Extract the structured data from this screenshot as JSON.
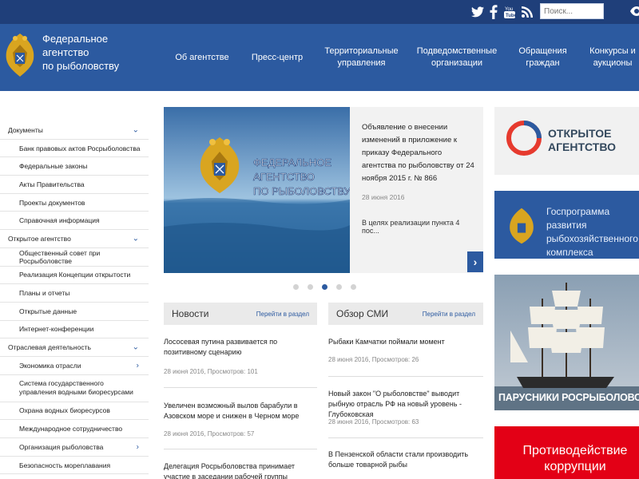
{
  "topbar": {
    "icons": [
      "twitter-icon",
      "facebook-icon",
      "youtube-icon",
      "rss-icon",
      "eye-icon"
    ],
    "search_placeholder": "Поиск...",
    "bg_color": "#1f3f7a"
  },
  "header": {
    "org_name_line1": "Федеральное",
    "org_name_line2": "агентство",
    "org_name_line3": "по рыболовству",
    "bg_color": "#2c5aa0",
    "nav": [
      {
        "label": "Об агентстве"
      },
      {
        "label": "Пресс-центр"
      },
      {
        "label": "Территориальные управления"
      },
      {
        "label": "Подведомственные организации"
      },
      {
        "label": "Обращения граждан"
      },
      {
        "label": "Конкурсы и аукционы"
      }
    ]
  },
  "sidebar": {
    "items": [
      {
        "label": "Документы"
      },
      {
        "label": "Банк правовых актов Росрыболовства"
      },
      {
        "label": "Федеральные законы"
      },
      {
        "label": "Акты Правительства"
      },
      {
        "label": "Проекты документов"
      },
      {
        "label": "Справочная информация"
      },
      {
        "label": "Открытое агентство"
      },
      {
        "label": "Общественный совет при Росрыболовстве"
      },
      {
        "label": "Реализация Концепции открытости"
      },
      {
        "label": "Планы и отчеты"
      },
      {
        "label": "Открытые данные"
      },
      {
        "label": "Интернет-конференции"
      },
      {
        "label": "Отраслевая деятельность"
      },
      {
        "label": "Экономика отрасли"
      },
      {
        "label": "Система государственного управления водными биоресурсами"
      },
      {
        "label": "Охрана водных биоресурсов"
      },
      {
        "label": "Международное сотрудничество"
      },
      {
        "label": "Организация рыболовства"
      },
      {
        "label": "Безопасность мореплавания"
      }
    ]
  },
  "slider": {
    "image_text_line1": "ФЕДЕРАЛЬНОЕ",
    "image_text_line2": "АГЕНТСТВО",
    "image_text_line3": "ПО РЫБОЛОВСТВУ",
    "title": "Объявление о внесении изменений в приложение к приказу Федерального агентства по рыболовству от 24 ноября 2015 г. № 866",
    "date": "28 июня 2016",
    "excerpt": "В целях реализации пункта 4 пос...",
    "dots_count": 5,
    "active_dot": 3
  },
  "news": {
    "title": "Новости",
    "link": "Перейти в раздел",
    "items": [
      {
        "title": "Лососевая путина развивается по позитивному сценарию",
        "meta": "28 июня 2016, Просмотров: 101"
      },
      {
        "title": "Увеличен возможный вылов барабули в Азовском море и снижен в Черном море",
        "meta": "28 июня 2016, Просмотров: 57"
      },
      {
        "title": "Делегация Росрыболовства принимает участие в заседании рабочей группы АНТКОМ",
        "meta": ""
      }
    ]
  },
  "media": {
    "title": "Обзор СМИ",
    "link": "Перейти в раздел",
    "items": [
      {
        "title": "Рыбаки Камчатки поймали момент",
        "meta": "28 июня 2016, Просмотров: 26"
      },
      {
        "title": "Новый закон \"О рыболовстве\" выводит рыбную отрасль РФ на новый уровень - Глубоковская",
        "meta": "28 июня 2016, Просмотров: 63"
      },
      {
        "title": "В Пензенской области стали производить больше товарной рыбы",
        "meta": ""
      }
    ]
  },
  "right": {
    "open_agency_line1": "ОТКРЫТОЕ",
    "open_agency_line2": "АГЕНТСТВО",
    "gosprogram": "Госпрограмма развития рыбохозяйственного комплекса",
    "ships": "ПАРУСНИКИ РОСРЫБОЛОВСТВА",
    "corruption": "Противодействие коррупции",
    "corruption_color": "#e30016"
  }
}
